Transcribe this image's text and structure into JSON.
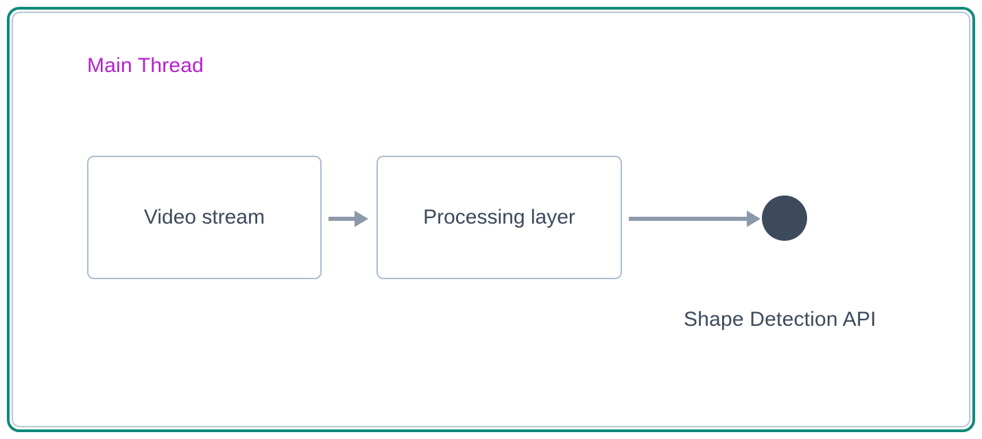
{
  "diagram": {
    "title": "Main Thread",
    "nodes": {
      "video": "Video stream",
      "processing": "Processing layer"
    },
    "endpoint": {
      "label": "Shape Detection API"
    }
  },
  "colors": {
    "outer_border": "#0f8a7a",
    "inner_border": "#b8c6d6",
    "node_border": "#aebccf",
    "title": "#b61fcf",
    "text": "#3d4a5c",
    "arrow": "#8c99a8",
    "circle": "#3d4a5c"
  }
}
